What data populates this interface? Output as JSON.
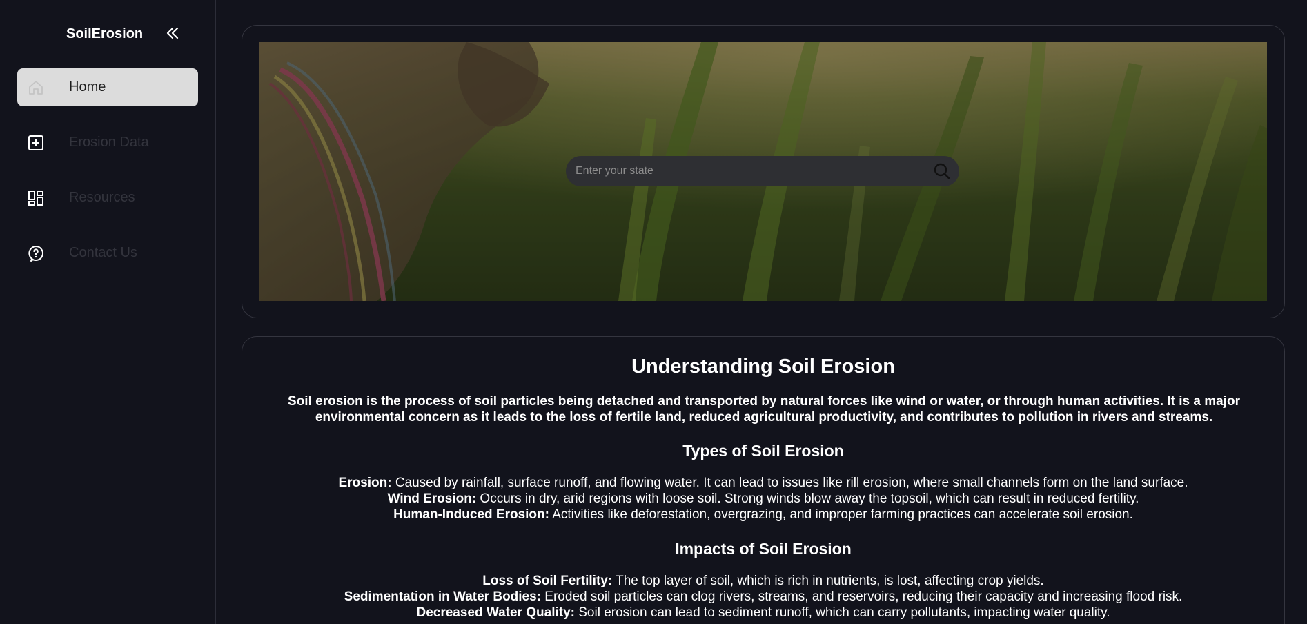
{
  "sidebar": {
    "brand": "SoilErosion",
    "items": [
      {
        "label": "Home",
        "icon": "home-icon",
        "active": true
      },
      {
        "label": "Erosion Data",
        "icon": "plus-square-icon",
        "active": false
      },
      {
        "label": "Resources",
        "icon": "dashboard-icon",
        "active": false
      },
      {
        "label": "Contact Us",
        "icon": "help-bubble-icon",
        "active": false
      }
    ]
  },
  "hero": {
    "search_placeholder": "Enter your state"
  },
  "content": {
    "title": "Understanding Soil Erosion",
    "intro": "Soil erosion is the process of soil particles being detached and transported by natural forces like wind or water, or through human activities. It is a major environmental concern as it leads to the loss of fertile land, reduced agricultural productivity, and contributes to pollution in rivers and streams.",
    "types": {
      "heading": "Types of Soil Erosion",
      "items": [
        {
          "term": "Erosion:",
          "text": " Caused by rainfall, surface runoff, and flowing water. It can lead to issues like rill erosion, where small channels form on the land surface."
        },
        {
          "term": "Wind Erosion:",
          "text": " Occurs in dry, arid regions with loose soil. Strong winds blow away the topsoil, which can result in reduced fertility."
        },
        {
          "term": "Human-Induced Erosion:",
          "text": " Activities like deforestation, overgrazing, and improper farming practices can accelerate soil erosion."
        }
      ]
    },
    "impacts": {
      "heading": "Impacts of Soil Erosion",
      "items": [
        {
          "term": "Loss of Soil Fertility:",
          "text": " The top layer of soil, which is rich in nutrients, is lost, affecting crop yields."
        },
        {
          "term": "Sedimentation in Water Bodies:",
          "text": " Eroded soil particles can clog rivers, streams, and reservoirs, reducing their capacity and increasing flood risk."
        },
        {
          "term": "Decreased Water Quality:",
          "text": " Soil erosion can lead to sediment runoff, which can carry pollutants, impacting water quality."
        }
      ]
    }
  }
}
